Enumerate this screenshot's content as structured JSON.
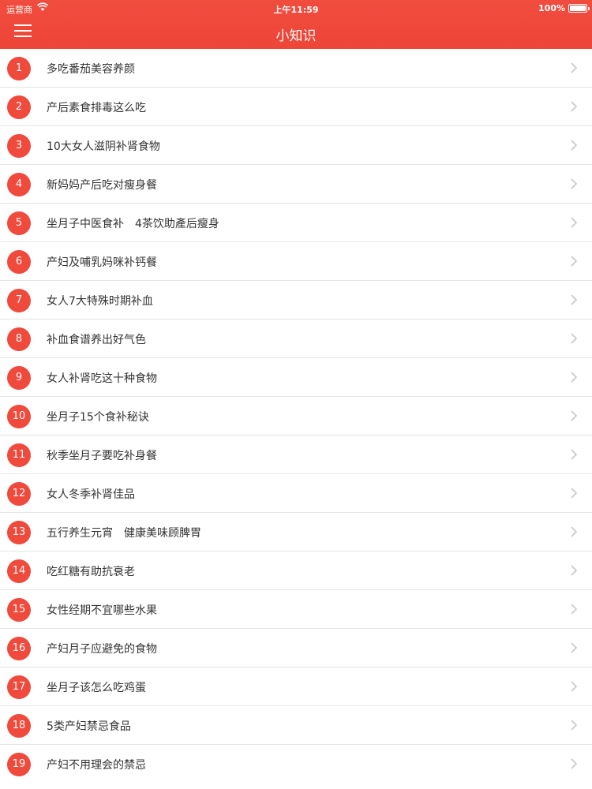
{
  "status_bar": {
    "carrier": "运营商",
    "time": "上午11:59",
    "battery": "100%"
  },
  "header": {
    "title": "小知识",
    "menu_icon": "hamburger-menu-icon"
  },
  "colors": {
    "accent": "#ef4a3c",
    "text": "#333333",
    "divider": "#e5e5e5",
    "chevron": "#c7c7cc"
  },
  "items": [
    {
      "number": "1",
      "title": "多吃番茄美容养颜"
    },
    {
      "number": "2",
      "title": "产后素食排毒这么吃"
    },
    {
      "number": "3",
      "title": "10大女人滋阴补肾食物"
    },
    {
      "number": "4",
      "title": "新妈妈产后吃对瘦身餐"
    },
    {
      "number": "5",
      "title": "坐月子中医食补　4茶饮助產后瘦身"
    },
    {
      "number": "6",
      "title": "产妇及哺乳妈咪补钙餐"
    },
    {
      "number": "7",
      "title": "女人7大特殊时期补血"
    },
    {
      "number": "8",
      "title": "补血食谱养出好气色"
    },
    {
      "number": "9",
      "title": "女人补肾吃这十种食物"
    },
    {
      "number": "10",
      "title": "坐月子15个食补秘诀"
    },
    {
      "number": "11",
      "title": "秋季坐月子要吃补身餐"
    },
    {
      "number": "12",
      "title": "女人冬季补肾佳品"
    },
    {
      "number": "13",
      "title": "五行养生元宵　健康美味顾脾胃"
    },
    {
      "number": "14",
      "title": "吃红糖有助抗衰老"
    },
    {
      "number": "15",
      "title": "女性经期不宜哪些水果"
    },
    {
      "number": "16",
      "title": "产妇月子应避免的食物"
    },
    {
      "number": "17",
      "title": "坐月子该怎么吃鸡蛋"
    },
    {
      "number": "18",
      "title": "5类产妇禁忌食品"
    },
    {
      "number": "19",
      "title": "产妇不用理会的禁忌"
    }
  ]
}
